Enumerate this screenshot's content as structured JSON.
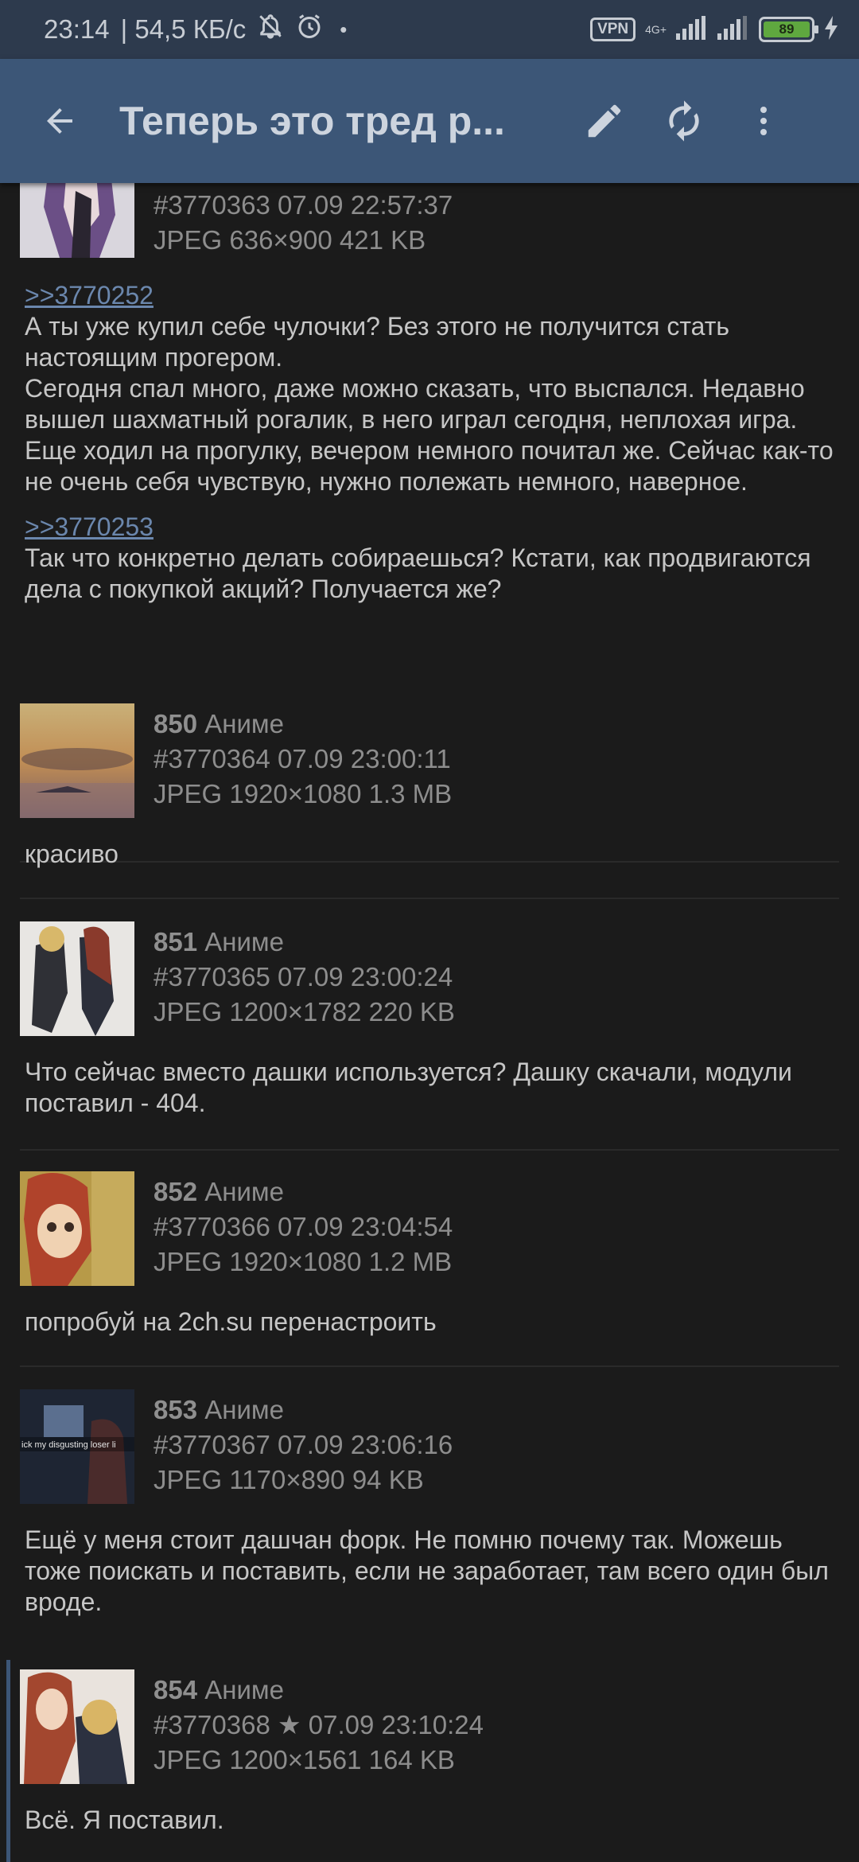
{
  "status_bar": {
    "time": "23:14",
    "speed": "| 54,5 КБ/с",
    "mute_icon": "bell-off-icon",
    "alarm_icon": "alarm-icon",
    "dot": "•",
    "vpn": "VPN",
    "network": "4G+",
    "battery": "89"
  },
  "app_bar": {
    "title": "Теперь это тред р...",
    "back_icon": "arrow-back-icon",
    "edit_icon": "pencil-icon",
    "refresh_icon": "refresh-icon",
    "menu_icon": "more-vert-icon"
  },
  "posts": [
    {
      "id": "#3770363",
      "date": "07.09 22:57:37",
      "file": "JPEG 636×900 421 KB",
      "reply1": ">>3770252",
      "text1": "А ты уже купил себе чулочки? Без этого не получится стать настоящим прогером.",
      "text1b": "Сегодня спал много, даже можно сказать, что выспался. Недавно вышел шахматный рогалик, в него играл сегодня, неплохая игра. Еще ходил на прогулку, вечером немного почитал же. Сейчас как-то не очень себя чувствую, нужно полежать немного, наверное.",
      "reply2": ">>3770253",
      "text2": "Так что конкретно делать собираешься? Кстати, как продвигаются дела с покупкой акций? Получается же?"
    },
    {
      "num": "850",
      "name": "Аниме",
      "id": "#3770364",
      "date": "07.09 23:00:11",
      "file": "JPEG 1920×1080 1.3 MB",
      "text": "красиво"
    },
    {
      "num": "851",
      "name": "Аниме",
      "id": "#3770365",
      "date": "07.09 23:00:24",
      "file": "JPEG 1200×1782 220 KB",
      "text": "Что сейчас вместо дашки используется? Дашку скачали, модули поставил - 404."
    },
    {
      "num": "852",
      "name": "Аниме",
      "id": "#3770366",
      "date": "07.09 23:04:54",
      "file": "JPEG 1920×1080 1.2 MB",
      "text": "попробуй на 2ch.su перенастроить"
    },
    {
      "num": "853",
      "name": "Аниме",
      "id": "#3770367",
      "date": "07.09 23:06:16",
      "file": "JPEG 1170×890 94 KB",
      "thumb_caption": "ick my disgusting loser li",
      "text": "Ещё у меня стоит дашчан форк. Не помню почему так. Можешь тоже поискать и поставить, если не заработает, там всего один был вроде."
    },
    {
      "num": "854",
      "name": "Аниме",
      "id": "#3770368",
      "star": "★",
      "date": "07.09 23:10:24",
      "file": "JPEG 1200×1561 164 KB",
      "text": "Всё. Я поставил."
    }
  ]
}
